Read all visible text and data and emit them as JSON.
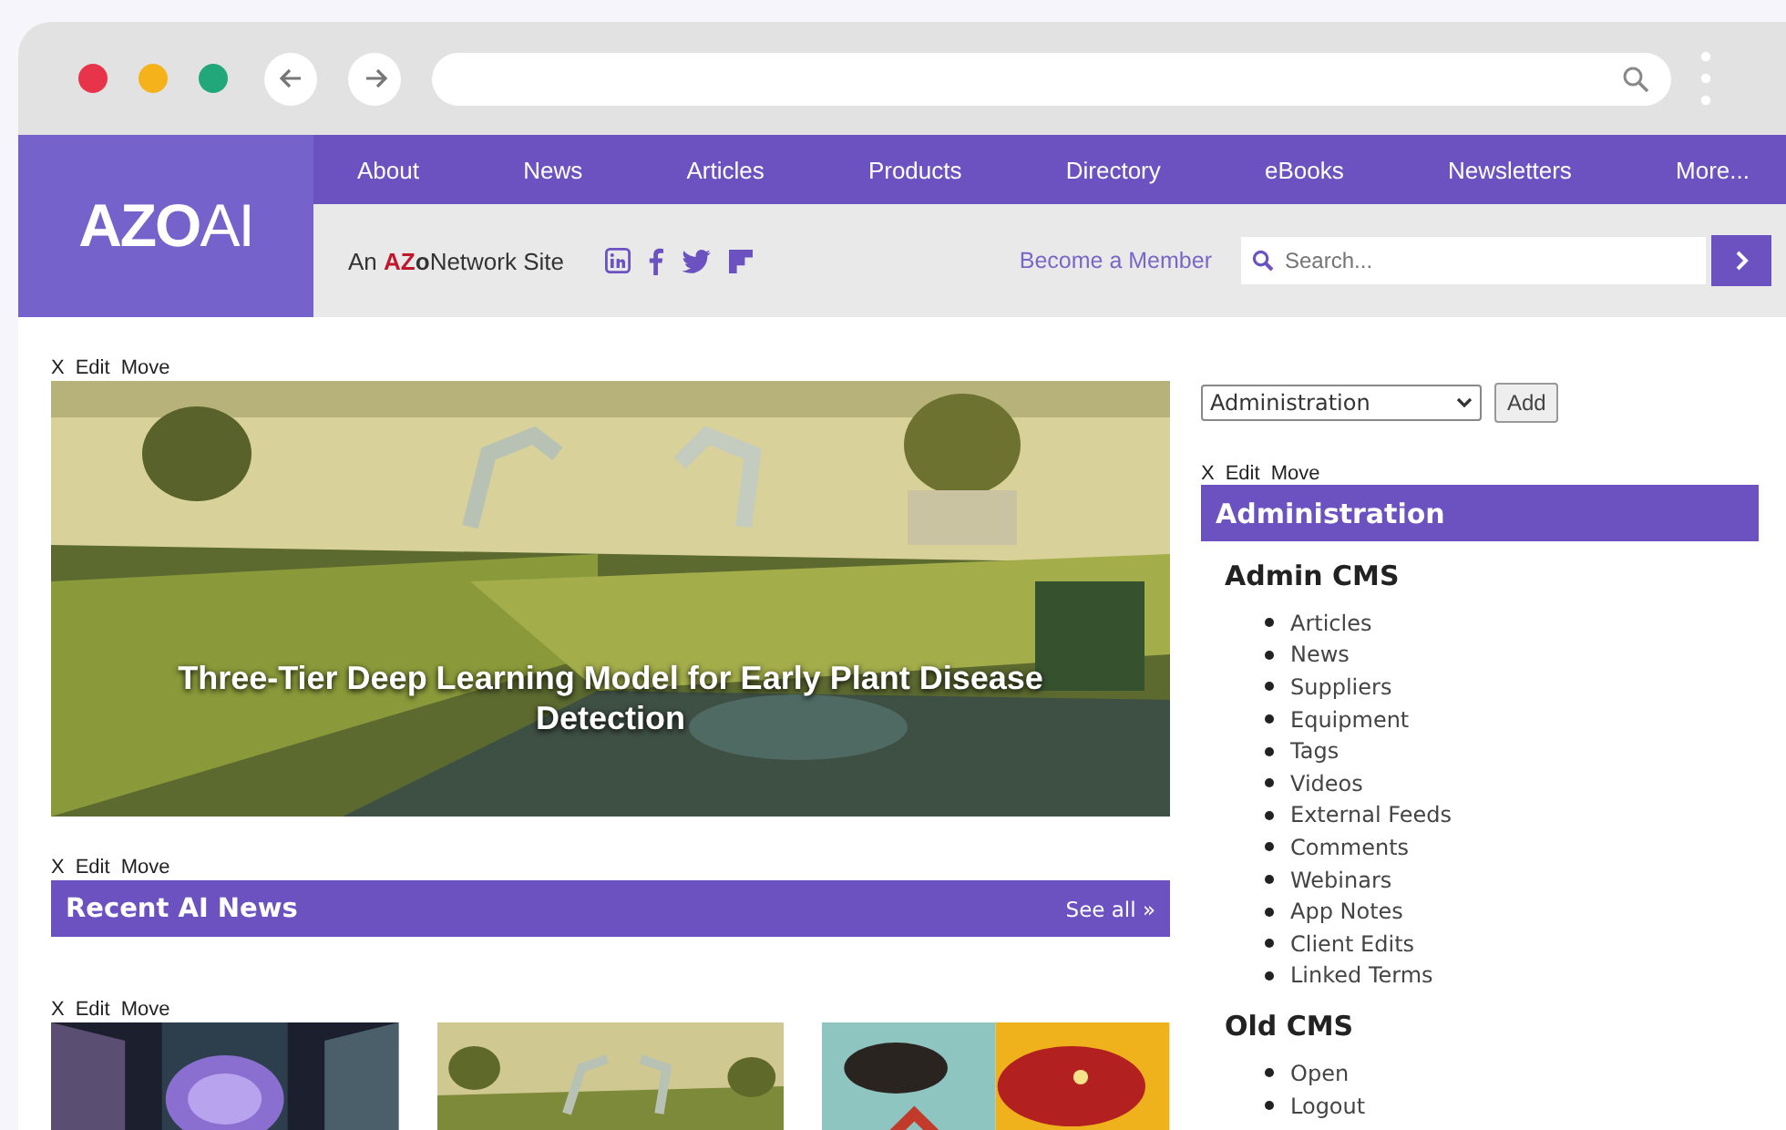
{
  "logo": {
    "bold": "AZO",
    "light": "AI"
  },
  "nav": [
    "About",
    "News",
    "Articles",
    "Products",
    "Directory",
    "eBooks",
    "Newsletters",
    "More..."
  ],
  "tagline": {
    "prefix": "An",
    "brand_a": "AZ",
    "brand_o": "o",
    "suffix": "Network Site"
  },
  "member_link": "Become a Member",
  "search": {
    "placeholder": "Search..."
  },
  "widget_controls": [
    [
      "X",
      "Edit",
      "Move"
    ],
    [
      "X",
      "Edit",
      "Move"
    ],
    [
      "X",
      "Edit",
      "Move"
    ],
    [
      "X",
      "Edit",
      "Move"
    ]
  ],
  "hero": {
    "caption": "Three-Tier Deep Learning Model for Early Plant Disease Detection"
  },
  "news_section": {
    "title": "Recent AI News",
    "see_all": "See all »"
  },
  "widget_picker": {
    "value": "Administration",
    "button": "Add"
  },
  "admin": {
    "title": "Administration",
    "groups": [
      {
        "heading": "Admin CMS",
        "items": [
          "Articles",
          "News",
          "Suppliers",
          "Equipment",
          "Tags",
          "Videos",
          "External Feeds",
          "Comments",
          "Webinars",
          "App Notes",
          "Client Edits",
          "Linked Terms"
        ]
      },
      {
        "heading": "Old CMS",
        "items": [
          "Open",
          "Logout"
        ]
      }
    ]
  }
}
